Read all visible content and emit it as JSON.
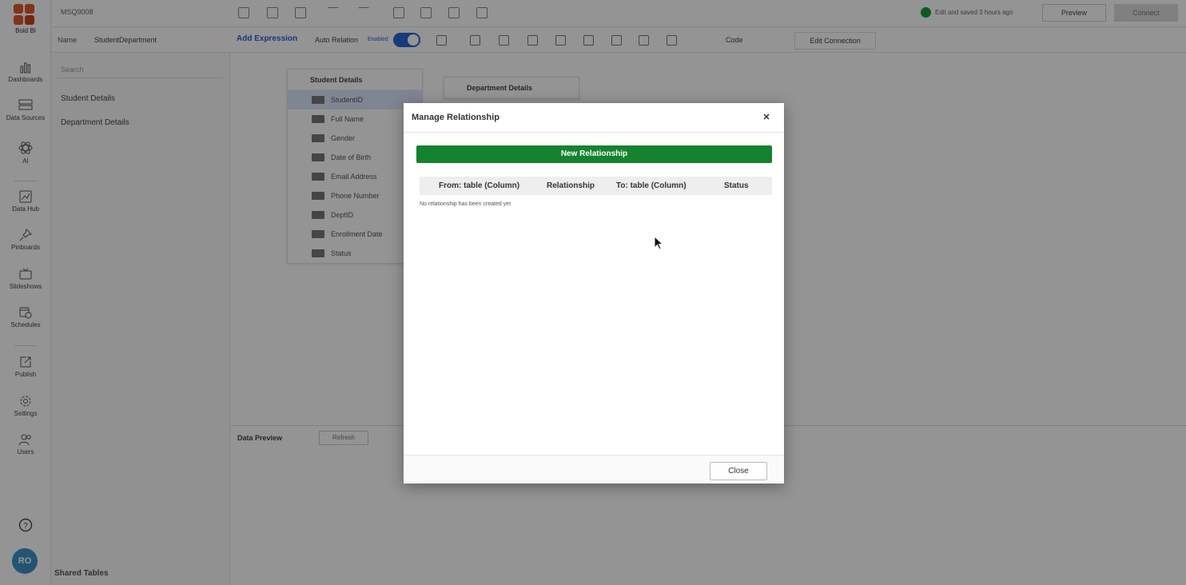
{
  "app": {
    "name": "Bold BI"
  },
  "nav": {
    "items": [
      {
        "label": "Dashboards",
        "icon": "bar-chart-icon"
      },
      {
        "label": "Data Sources",
        "icon": "data-sources-icon"
      },
      {
        "label": "AI",
        "icon": "atom-icon"
      },
      {
        "label": "Data Hub",
        "icon": "data-hub-icon"
      },
      {
        "label": "Pinboards",
        "icon": "pin-icon"
      },
      {
        "label": "Slideshows",
        "icon": "slideshow-icon"
      },
      {
        "label": "Schedules",
        "icon": "schedule-icon"
      },
      {
        "label": "Publish",
        "icon": "publish-icon"
      },
      {
        "label": "Settings",
        "icon": "gear-icon"
      },
      {
        "label": "Users",
        "icon": "users-icon"
      }
    ],
    "help_icon": "help-icon",
    "avatar_initials": "RO"
  },
  "topbar": {
    "datasource_name": "MSQ9008",
    "saved_text": "Edit and saved 3 hours ago",
    "preview_label": "Preview",
    "connect_label": "Connect"
  },
  "subbar": {
    "name_label": "Name",
    "name_value": "StudentDepartment",
    "add_expression": "Add Expression",
    "auto_relation_label": "Auto Relation",
    "auto_relation_state": "Enabled",
    "code_label": "Code",
    "edit_connection": "Edit Connection"
  },
  "left_panel": {
    "search_placeholder": "Search",
    "tables": [
      "Student Details",
      "Department Details"
    ],
    "shared_tables": "Shared Tables"
  },
  "canvas": {
    "student_table": {
      "title": "Student Details",
      "columns": [
        "StudentID",
        "Full Name",
        "Gender",
        "Date of Birth",
        "Email Address",
        "Phone Number",
        "DeptID",
        "Enrollment Date",
        "Status"
      ]
    },
    "department_table": {
      "title": "Department Details"
    }
  },
  "bottom": {
    "data_preview": "Data Preview",
    "refresh": "Refresh"
  },
  "modal": {
    "title": "Manage Relationship",
    "close_icon": "close-icon",
    "new_relationship": "New Relationship",
    "columns": [
      "From: table (Column)",
      "Relationship",
      "To: table (Column)",
      "Status"
    ],
    "empty_message": "No relationship has been created yet",
    "close_button": "Close"
  },
  "colors": {
    "accent_green": "#14822f",
    "accent_blue": "#2a62d6",
    "logo_red": "#e05a2b",
    "avatar": "#3b93c7"
  }
}
